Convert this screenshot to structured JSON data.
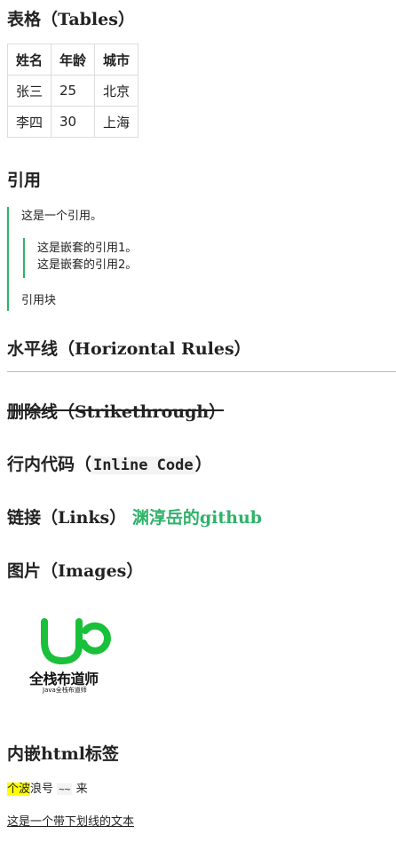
{
  "sections": {
    "tables": {
      "heading": "表格（Tables）",
      "headers": [
        "姓名",
        "年龄",
        "城市"
      ],
      "rows": [
        [
          "张三",
          "25",
          "北京"
        ],
        [
          "李四",
          "30",
          "上海"
        ]
      ]
    },
    "quote": {
      "heading": "引用",
      "line1": "这是一个引用。",
      "nested1": "这是嵌套的引用1。",
      "nested2": "这是嵌套的引用2。",
      "line_last": "引用块"
    },
    "hr": {
      "heading": "水平线（Horizontal Rules）"
    },
    "strike": {
      "heading": "删除线（Strikethrough）"
    },
    "inline_code": {
      "heading_prefix": "行内代码（",
      "code": "Inline Code",
      "heading_suffix": "）"
    },
    "links": {
      "heading": "链接（Links）",
      "link_text": "渊淳岳的github",
      "link_color": "#2fb26a"
    },
    "images": {
      "heading": "图片（Images）",
      "logo_icon": "cup-icon",
      "logo_color": "#19c03a",
      "logo_title": "全栈布道师",
      "logo_subtitle": "Java全栈布道师"
    },
    "html_tags": {
      "heading": "内嵌html标签",
      "highlight": "个波",
      "mid_text": "浪号",
      "code": "~~",
      "end_text": "来",
      "highlight_color": "#ffff00",
      "underline_text": "这是一个带下划线的文本"
    }
  }
}
